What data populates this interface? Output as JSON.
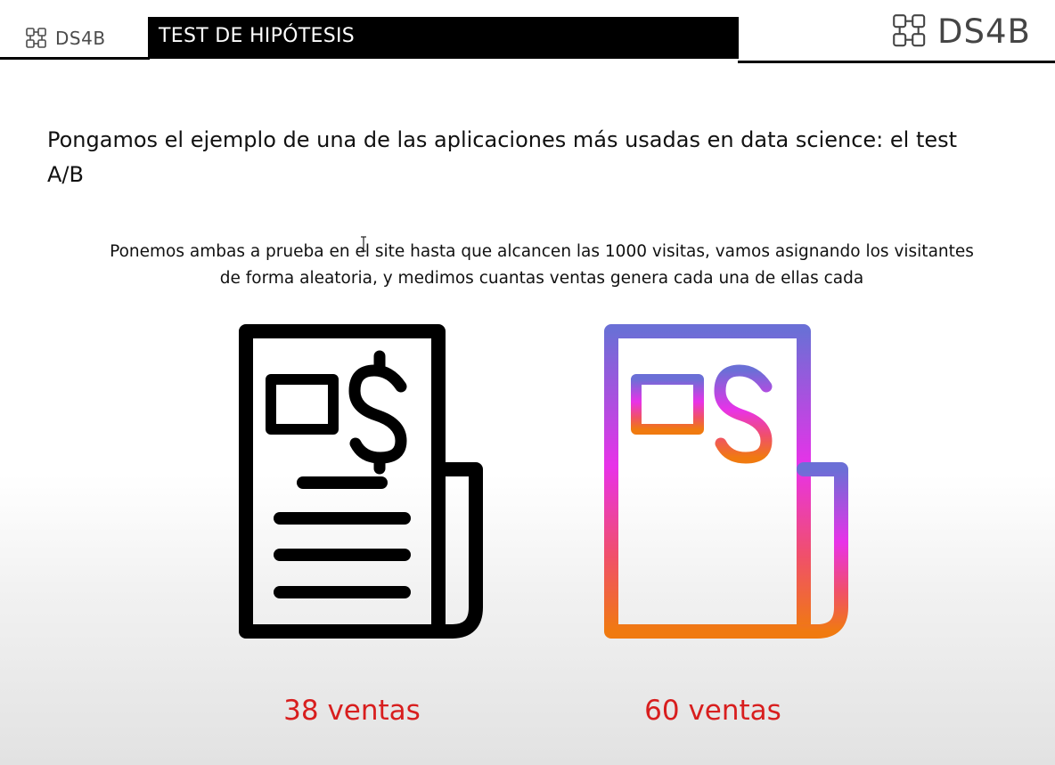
{
  "header": {
    "logo_small_text": "DS4B",
    "title": "TEST DE HIPÓTESIS",
    "logo_big_text": "DS4B"
  },
  "intro": {
    "text": "Pongamos el ejemplo de una de las aplicaciones más usadas en data science: el test A/B"
  },
  "description": {
    "line1": "Ponemos ambas a prueba en el site hasta que alcancen las 1000 visitas, vamos asignando los visitantes",
    "line2": "de forma aleatoria, y medimos cuantas ventas genera cada una de ellas cada"
  },
  "variants": [
    {
      "icon": "invoice-icon",
      "style": "black",
      "sales_label": "38 ventas"
    },
    {
      "icon": "invoice-icon",
      "style": "gradient",
      "sales_label": "60 ventas"
    }
  ],
  "colors": {
    "sales_text": "#d81e1e",
    "gradient_top": "#6b6fd6",
    "gradient_mid": "#e832e8",
    "gradient_bottom": "#f07a10",
    "title_bar": "#000000"
  }
}
